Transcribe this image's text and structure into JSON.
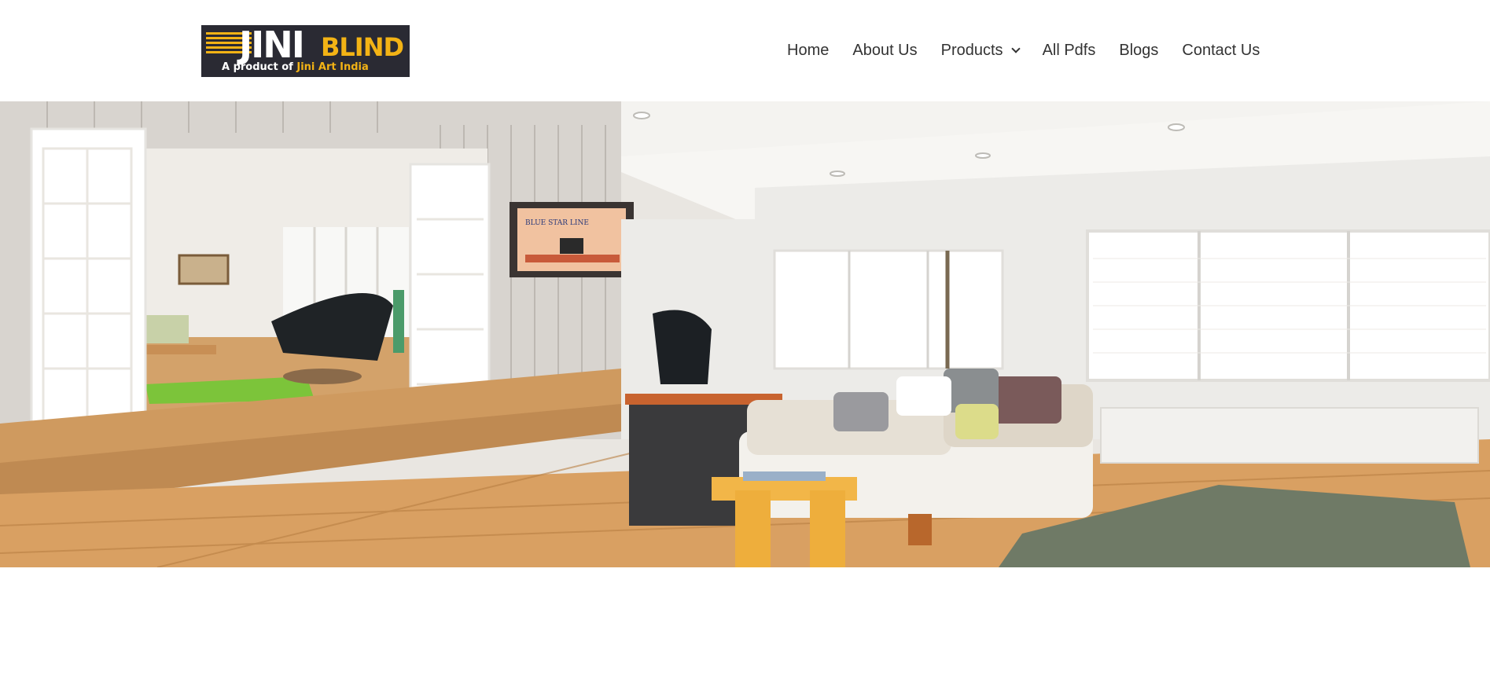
{
  "brand": {
    "logo_primary": "JINI",
    "logo_secondary": "BLIND",
    "tagline_prefix": "A product of ",
    "tagline_highlight": "Jini Art India",
    "accent_color": "#f3b315",
    "logo_bg": "#2a2a33"
  },
  "nav": {
    "items": [
      {
        "label": "Home"
      },
      {
        "label": "About Us"
      },
      {
        "label": "Products",
        "has_dropdown": true
      },
      {
        "label": "All Pdfs"
      },
      {
        "label": "Blogs"
      },
      {
        "label": "Contact Us"
      }
    ]
  },
  "hero": {
    "poster_text": "BLUE STAR LINE",
    "slides_count": 3,
    "active_slide": 1
  }
}
